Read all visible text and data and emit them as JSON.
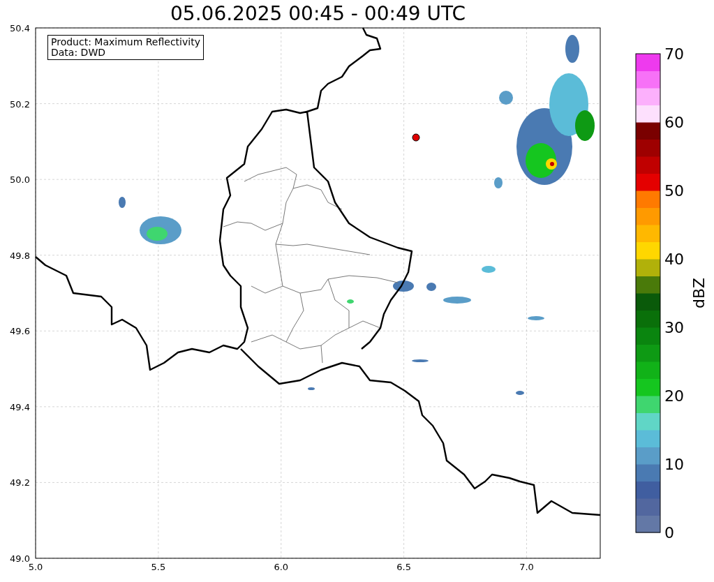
{
  "title": "05.06.2025 00:45 - 00:49 UTC",
  "legend": [
    "Product: Maximum Reflectivity",
    "Data: DWD"
  ],
  "axes": {
    "xticks": [
      "5.0",
      "5.5",
      "6.0",
      "6.5",
      "7.0"
    ],
    "yticks": [
      "50.4",
      "50.2",
      "50.0",
      "49.8",
      "49.6",
      "49.4",
      "49.2",
      "49.0"
    ]
  },
  "colorbar": {
    "label": "dBZ",
    "ticks": [
      "70",
      "60",
      "50",
      "40",
      "30",
      "20",
      "10",
      "0"
    ],
    "bins": [
      {
        "color": "#6378a6"
      },
      {
        "color": "#52679f"
      },
      {
        "color": "#405ea0"
      },
      {
        "color": "#4a7ab2"
      },
      {
        "color": "#5a9dc8"
      },
      {
        "color": "#5bbcd8"
      },
      {
        "color": "#60d6c6"
      },
      {
        "color": "#3fd66f"
      },
      {
        "color": "#15c61f"
      },
      {
        "color": "#11b218"
      },
      {
        "color": "#0e9a14"
      },
      {
        "color": "#0a850f"
      },
      {
        "color": "#0a700a"
      },
      {
        "color": "#0a5a0a"
      },
      {
        "color": "#4a7a0a"
      },
      {
        "color": "#b1b10a"
      },
      {
        "color": "#ffd700"
      },
      {
        "color": "#ffb800"
      },
      {
        "color": "#ff9a00"
      },
      {
        "color": "#ff7a00"
      },
      {
        "color": "#e40000"
      },
      {
        "color": "#c00000"
      },
      {
        "color": "#9e0000"
      },
      {
        "color": "#7a0000"
      },
      {
        "color": "#fde0fd"
      },
      {
        "color": "#fcb0fc"
      },
      {
        "color": "#f771f7"
      },
      {
        "color": "#ee3aee"
      }
    ]
  }
}
